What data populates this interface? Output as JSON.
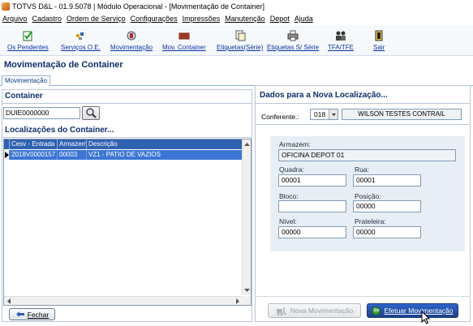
{
  "window": {
    "title": "TOTVS D&L - 01.9.5078 | Módulo Operacional - [Movimentação de Container]"
  },
  "menu": [
    "Arquivo",
    "Cadastro",
    "Ordem de Serviço",
    "Configurações",
    "Impressões",
    "Manutenção",
    "Depot",
    "Ajuda"
  ],
  "toolbar": [
    {
      "label": "Os Pendentes",
      "icon": "check-clipboard-icon"
    },
    {
      "label": "Serviços O.E.",
      "icon": "services-icon"
    },
    {
      "label": "Movimentação",
      "icon": "movement-icon"
    },
    {
      "label": "Mov. Container",
      "icon": "container-icon"
    },
    {
      "label": "Etiquetas(Série)",
      "icon": "labels-icon"
    },
    {
      "label": "Etiquetas S/ Série",
      "icon": "printer-icon"
    },
    {
      "label": "TFA/TFE",
      "icon": "people-icon"
    },
    {
      "label": "Sair",
      "icon": "exit-door-icon"
    }
  ],
  "page": {
    "title": "Movimentação de Container",
    "tab": "Movimentação"
  },
  "container": {
    "title": "Container",
    "value": "DUIE0000000",
    "locations_title": "Localizações do Container...",
    "columns": [
      "Cesv - Entrada",
      "Armazem",
      "Descrição"
    ],
    "rows": [
      {
        "cesv": "2018V0000157",
        "armazem": "00003",
        "descricao": "VZ1 - PATIO DE VAZIOS"
      }
    ],
    "close_label": "Fechar"
  },
  "new_location": {
    "title": "Dados para a Nova Localização...",
    "conferente_label": "Conferente.:",
    "conferente_code": "018",
    "conferente_name": "WILSON TESTES CONTRAIL",
    "armazem_label": "Armazém:",
    "armazem_value": "OFICINA DEPOT 01",
    "quadra_label": "Quadra:",
    "quadra_value": "00001",
    "rua_label": "Rua:",
    "rua_value": "00001",
    "bloco_label": "Bloco:",
    "bloco_value": "",
    "posicao_label": "Posição:",
    "posicao_value": "00000",
    "nivel_label": "Nível:",
    "nivel_value": "00000",
    "prateleira_label": "Prateleira:",
    "prateleira_value": "00000",
    "btn_nova": "Nova Movimentação",
    "btn_efetuar": "Efetuar Movimentação",
    "go_badge": "Go"
  }
}
